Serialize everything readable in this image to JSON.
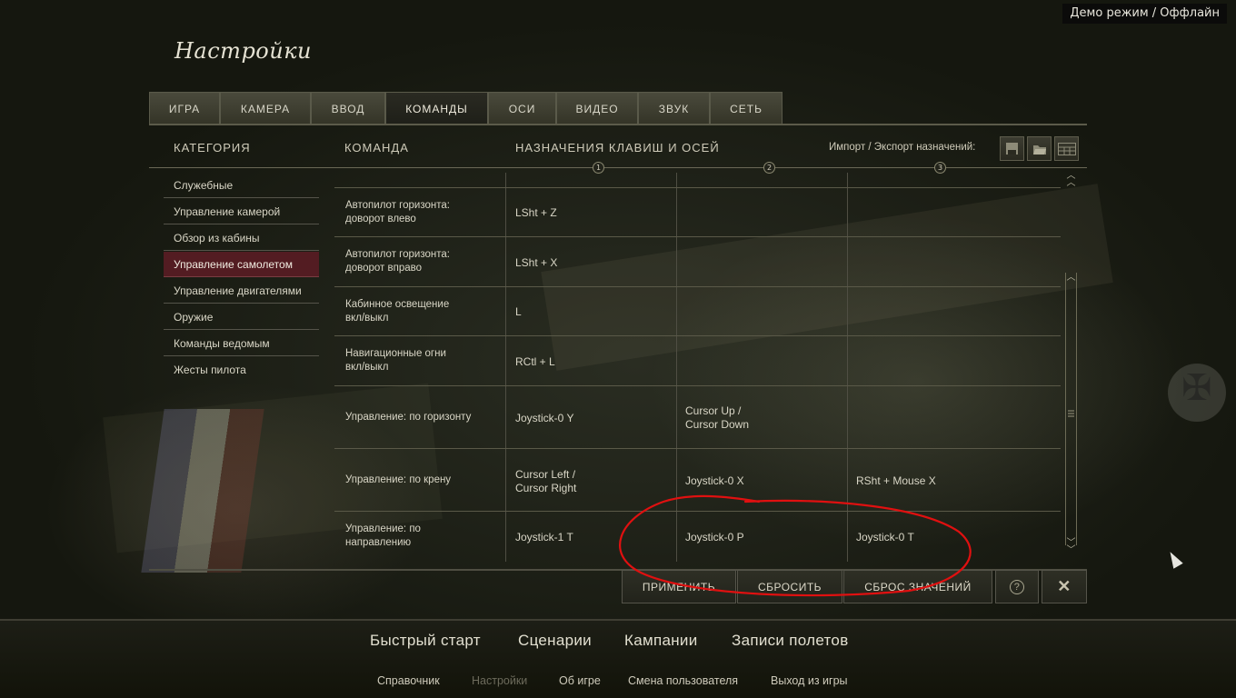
{
  "status": "Демо режим / Оффлайн",
  "title": "Настройки",
  "tabs": [
    "ИГРА",
    "КАМЕРА",
    "ВВОД",
    "КОМАНДЫ",
    "ОСИ",
    "ВИДЕО",
    "ЗВУК",
    "СЕТЬ"
  ],
  "active_tab": "КОМАНДЫ",
  "headers": {
    "category": "КАТЕГОРИЯ",
    "command": "КОМАНДА",
    "bindings": "НАЗНАЧЕНИЯ КЛАВИШ И ОСЕЙ",
    "import_export": "Импорт / Экспорт назначений:",
    "col_numbers": [
      "1",
      "2",
      "3"
    ]
  },
  "icons": [
    "save-icon",
    "folder-open-icon",
    "keyboard-layout-icon"
  ],
  "categories": [
    "Служебные",
    "Управление камерой",
    "Обзор из кабины",
    "Управление самолетом",
    "Управление двигателями",
    "Оружие",
    "Команды ведомым",
    "Жесты пилота"
  ],
  "active_category": "Управление самолетом",
  "rows": [
    {
      "command": [
        "Автопилот горизонта:",
        "доворот влево"
      ],
      "b1": [
        "LSht + Z"
      ],
      "b2": [],
      "b3": []
    },
    {
      "command": [
        "Автопилот горизонта:",
        "доворот вправо"
      ],
      "b1": [
        "LSht + X"
      ],
      "b2": [],
      "b3": []
    },
    {
      "command": [
        "Кабинное освещение",
        "вкл/выкл"
      ],
      "b1": [
        "L"
      ],
      "b2": [],
      "b3": []
    },
    {
      "command": [
        "Навигационные огни",
        "вкл/выкл"
      ],
      "b1": [
        "RCtl + L"
      ],
      "b2": [],
      "b3": []
    },
    {
      "command": [
        "Управление: по горизонту"
      ],
      "b1": [
        "Joystick-0 Y"
      ],
      "b2": [
        "Cursor Up /",
        "Cursor Down"
      ],
      "b3": []
    },
    {
      "command": [
        "Управление: по крену"
      ],
      "b1": [
        "Cursor Left /",
        "Cursor Right"
      ],
      "b2": [
        "Joystick-0 X"
      ],
      "b3": [
        "RSht + Mouse X"
      ]
    },
    {
      "command": [
        "Управление: по",
        "направлению"
      ],
      "b1": [
        "Joystick-1 T"
      ],
      "b2": [
        "Joystick-0 P"
      ],
      "b3": [
        "Joystick-0 T"
      ]
    }
  ],
  "buttons": {
    "apply": "ПРИМЕНИТЬ",
    "reset": "СБРОСИТЬ",
    "reset_values": "СБРОС ЗНАЧЕНИЙ",
    "help": "?",
    "close": "✕"
  },
  "main_nav": [
    "Быстрый старт",
    "Сценарии",
    "Кампании",
    "Записи полетов"
  ],
  "sub_nav": [
    "Справочник",
    "Настройки",
    "Об игре",
    "Смена пользователя",
    "Выход из игры"
  ],
  "active_sub_nav": "Настройки",
  "annotation_color": "#e01010"
}
